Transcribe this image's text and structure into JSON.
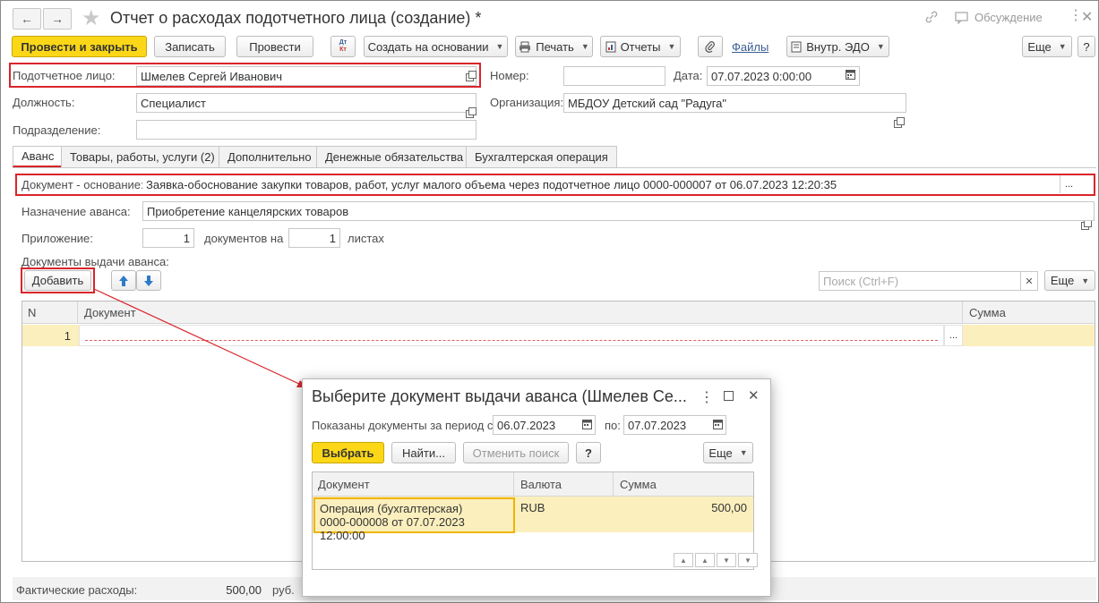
{
  "header": {
    "title": "Отчет о расходах подотчетного лица (создание) *",
    "discussion": "Обсуждение"
  },
  "toolbar": {
    "post_close": "Провести и закрыть",
    "save": "Записать",
    "post": "Провести",
    "dtkt": "Дт\nКт",
    "create_based": "Создать на основании",
    "print": "Печать",
    "reports": "Отчеты",
    "files": "Файлы",
    "edo": "Внутр. ЭДО",
    "more": "Еще",
    "help": "?"
  },
  "form": {
    "person_label": "Подотчетное лицо:",
    "person_value": "Шмелев Сергей Иванович",
    "number_label": "Номер:",
    "number_value": "",
    "date_label": "Дата:",
    "date_value": "07.07.2023  0:00:00",
    "position_label": "Должность:",
    "position_value": "Специалист",
    "org_label": "Организация:",
    "org_value": "МБДОУ Детский сад \"Радуга\"",
    "dept_label": "Подразделение:",
    "dept_value": ""
  },
  "tabs": [
    {
      "label": "Аванс",
      "active": true
    },
    {
      "label": "Товары, работы, услуги (2)",
      "active": false
    },
    {
      "label": "Дополнительно",
      "active": false
    },
    {
      "label": "Денежные обязательства",
      "active": false
    },
    {
      "label": "Бухгалтерская операция",
      "active": false
    }
  ],
  "advance": {
    "basis_label": "Документ - основание:",
    "basis_value": "Заявка-обоснование закупки товаров, работ, услуг малого объема через подотчетное лицо 0000-000007 от 06.07.2023 12:20:35",
    "purpose_label": "Назначение аванса:",
    "purpose_value": "Приобретение канцелярских товаров",
    "attach_label": "Приложение:",
    "attach_docs": "1",
    "docs_on": "документов на",
    "attach_sheets": "1",
    "sheets": "листах",
    "issue_docs_label": "Документы выдачи аванса:",
    "add_button": "Добавить",
    "search_placeholder": "Поиск (Ctrl+F)",
    "more": "Еще",
    "table": {
      "columns": [
        "N",
        "Документ",
        "Сумма"
      ],
      "rows": [
        {
          "n": "1",
          "doc": "",
          "sum": ""
        }
      ]
    }
  },
  "footer": {
    "actual_label": "Фактические расходы:",
    "actual_value": "500,00",
    "currency": "руб."
  },
  "dialog": {
    "title": "Выберите документ выдачи аванса (Шмелев Се...",
    "period_label": "Показаны документы за период с:",
    "date_from": "06.07.2023",
    "to_label": "по:",
    "date_to": "07.07.2023",
    "select": "Выбрать",
    "find": "Найти...",
    "cancel_search": "Отменить поиск",
    "help": "?",
    "more": "Еще",
    "columns": [
      "Документ",
      "Валюта",
      "Сумма"
    ],
    "rows": [
      {
        "doc_line1": "Операция (бухгалтерская)",
        "doc_line2": "0000-000008 от 07.07.2023 12:00:00",
        "currency": "RUB",
        "sum": "500,00"
      }
    ]
  },
  "colors": {
    "accent_yellow": "#fbd718",
    "highlight_red": "#d9252b",
    "selected_row": "#fbefbd",
    "link_blue": "#3a5e95"
  }
}
